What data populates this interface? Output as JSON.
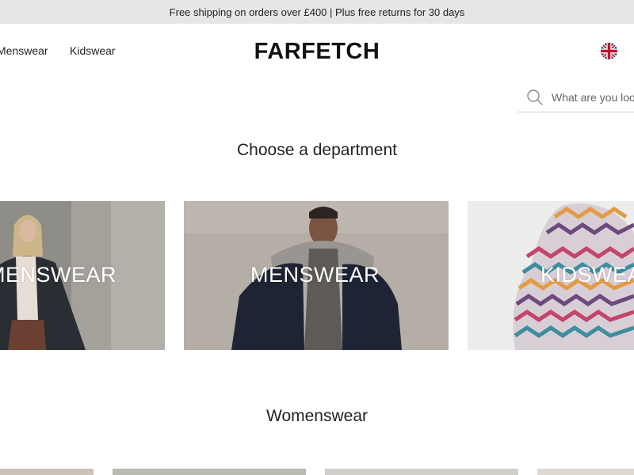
{
  "promo": {
    "text": "Free shipping on orders over £400 | Plus free returns for 30 days"
  },
  "header": {
    "nav": [
      {
        "label": "Menswear"
      },
      {
        "label": "Kidswear"
      }
    ],
    "logo": "FARFETCH",
    "locale_icon": "uk-flag-icon"
  },
  "search": {
    "placeholder": "What are you looking for?",
    "value": ""
  },
  "departments": {
    "title": "Choose a department",
    "tiles": [
      {
        "label": "MENSWEAR"
      },
      {
        "label": "MENSWEAR"
      },
      {
        "label": "KIDSWEAR"
      }
    ]
  },
  "womenswear": {
    "title": "Womenswear"
  },
  "colors": {
    "promo_bg": "#e6e6e6",
    "tile_text": "#ffffff",
    "text": "#222222"
  }
}
